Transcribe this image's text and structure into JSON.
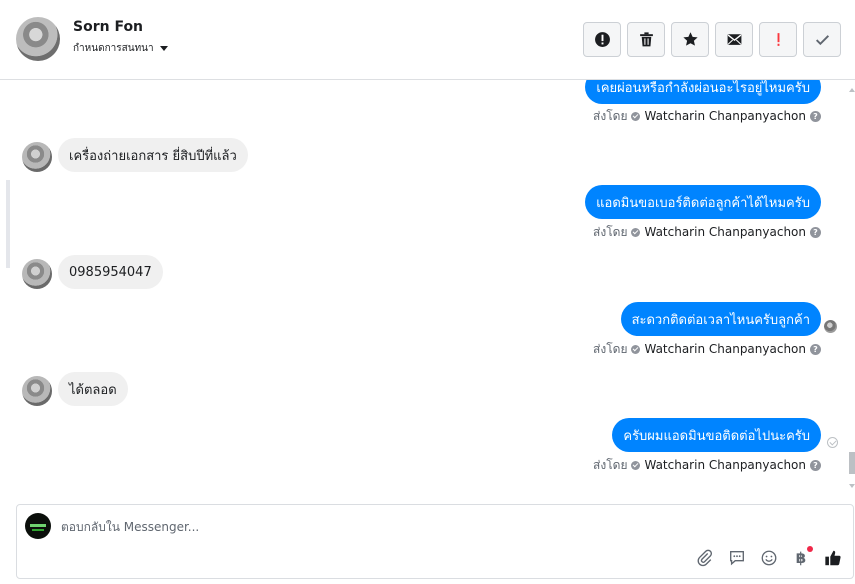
{
  "header": {
    "contact_name": "Sorn Fon",
    "assign_label": "กำหนดการสนทนา",
    "toolbar": [
      {
        "name": "report-spam-icon",
        "color": "#1c1e21"
      },
      {
        "name": "delete-icon",
        "color": "#1c1e21"
      },
      {
        "name": "star-icon",
        "color": "#1c1e21"
      },
      {
        "name": "mark-unread-icon",
        "color": "#1c1e21"
      },
      {
        "name": "follow-up-icon",
        "color": "#fa383e"
      },
      {
        "name": "done-check-icon",
        "color": "#606770"
      }
    ]
  },
  "messages": [
    {
      "side": "out",
      "text": "เคยผ่อนหรือกำลังผ่อนอะไรอยู่ไหมครับ",
      "sent_by_label": "ส่งโดย",
      "sent_by": "Watcharin Chanpanyachon"
    },
    {
      "side": "in",
      "text": "เครื่องถ่ายเอกสาร ยี่สิบปีที่แล้ว"
    },
    {
      "side": "out",
      "text": "แอดมินขอเบอร์ติดต่อลูกค้าได้ไหมครับ",
      "sent_by_label": "ส่งโดย",
      "sent_by": "Watcharin Chanpanyachon"
    },
    {
      "side": "in",
      "text": "0985954047"
    },
    {
      "side": "out",
      "text": "สะดวกติดต่อเวลาไหนครับลูกค้า",
      "sent_by_label": "ส่งโดย",
      "sent_by": "Watcharin Chanpanyachon"
    },
    {
      "side": "in",
      "text": "ได้ตลอด"
    },
    {
      "side": "out",
      "text": "ครับผมแอดมินขอติดต่อไปนะครับ",
      "sent_by_label": "ส่งโดย",
      "sent_by": "Watcharin Chanpanyachon"
    }
  ],
  "composer": {
    "placeholder": "ตอบกลับใน Messenger...",
    "tools": [
      "attach-icon",
      "saved-replies-icon",
      "emoji-icon",
      "payment-icon",
      "like-icon"
    ],
    "payment_symbol": "฿"
  },
  "colors": {
    "accent": "#0084ff",
    "incoming": "#f0f0f0",
    "alert": "#fa383e"
  }
}
